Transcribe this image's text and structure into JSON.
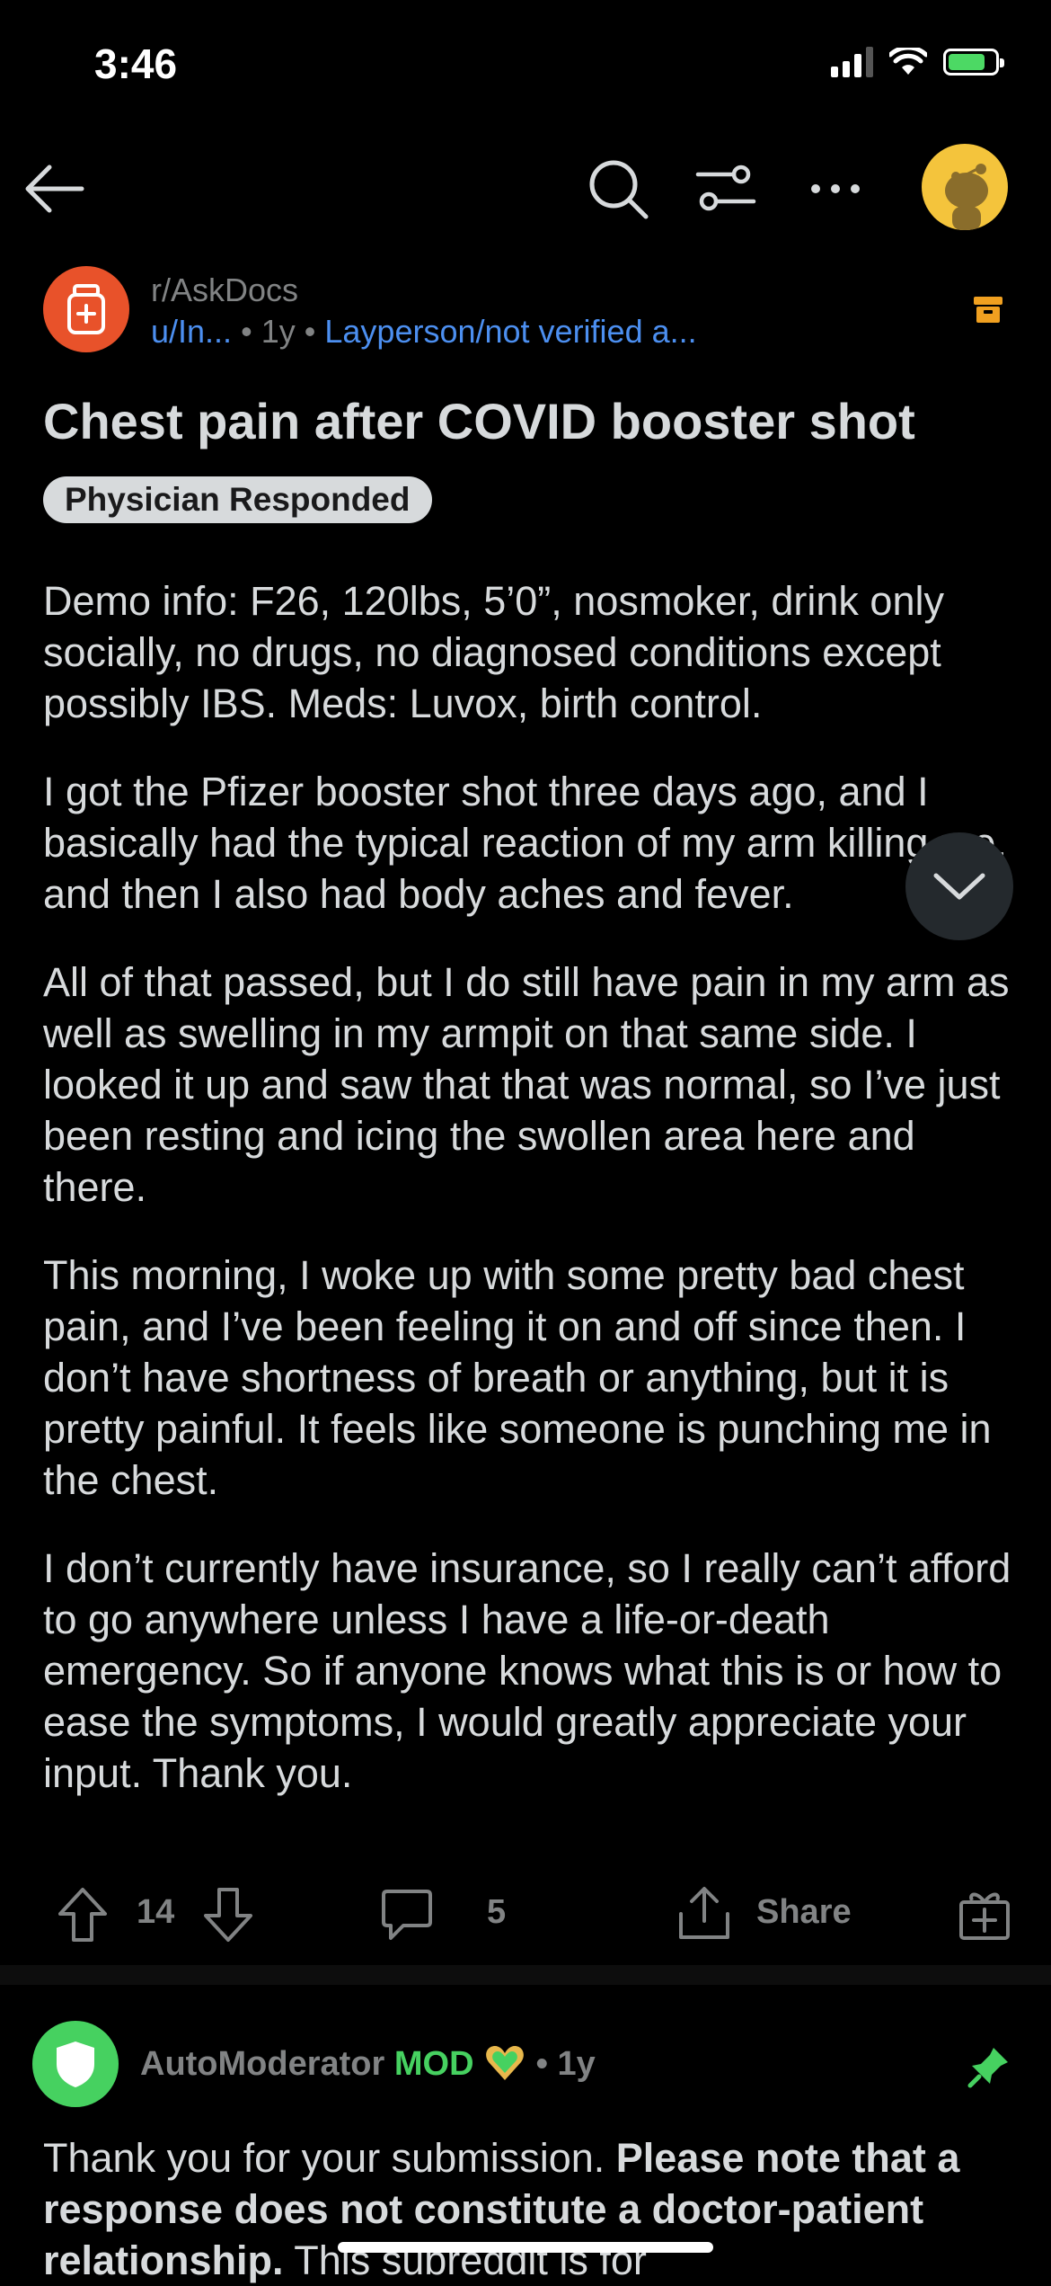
{
  "status_bar": {
    "time": "3:46"
  },
  "post": {
    "subreddit": "r/AskDocs",
    "author": "u/In...",
    "separator": "•",
    "age": "1y",
    "user_flair": "Layperson/not verified a...",
    "title": "Chest pain after COVID booster shot",
    "post_flair": "Physician Responded",
    "paragraphs": [
      "Demo info: F26, 120lbs, 5’0”, nosmoker, drink only socially, no drugs, no diagnosed conditions except possibly IBS. Meds: Luvox, birth control.",
      "I got the Pfizer booster shot three days ago, and I basically had the typical reaction of my arm killing me, and then I also had body aches and fever.",
      "All of that passed, but I do still have pain in my arm as well as swelling in my armpit on that same side. I looked it up and saw that that was normal, so I’ve just been resting and icing the swollen area here and there.",
      "This morning, I woke up with some pretty bad chest pain, and I’ve been feeling it on and off since then. I don’t have shortness of breath or anything, but it is pretty painful. It feels like someone is punching me in the chest.",
      "I don’t currently have insurance, so I really can’t afford to go anywhere unless I have a life-or-death emergency. So if anyone knows what this is or how to ease the symptoms, I would greatly appreciate your input. Thank you."
    ],
    "votes": "14",
    "comments": "5",
    "share_label": "Share"
  },
  "comment": {
    "author": "AutoModerator",
    "mod_label": "MOD",
    "separator": "•",
    "age": "1y",
    "text_lead": "Thank you for your submission. ",
    "text_bold": "Please note that a response does not constitute a doctor-patient relationship.",
    "text_tail": " This subreddit is for"
  },
  "colors": {
    "background": "#000000",
    "link_blue": "#4c8ff0",
    "subreddit_orange": "#e8522a",
    "mod_green": "#46d160",
    "avatar_yellow": "#f4c43c",
    "archive_orange": "#f0a020"
  },
  "icons": [
    "back-arrow-icon",
    "search-icon",
    "filter-icon",
    "more-icon",
    "snoo-avatar-icon",
    "medical-kit-icon",
    "archive-icon",
    "chevron-down-icon",
    "upvote-icon",
    "downvote-icon",
    "comment-icon",
    "share-icon",
    "award-icon",
    "shield-icon",
    "heart-badge-icon",
    "pin-icon"
  ]
}
